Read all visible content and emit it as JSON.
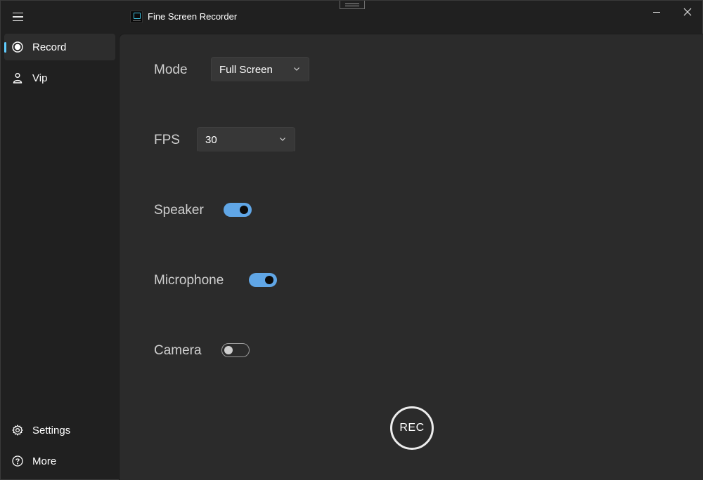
{
  "window": {
    "title": "Fine Screen Recorder"
  },
  "sidebar": {
    "top_items": [
      {
        "label": "Record",
        "icon": "record-icon",
        "selected": true
      },
      {
        "label": "Vip",
        "icon": "person-icon",
        "selected": false
      }
    ],
    "bottom_items": [
      {
        "label": "Settings",
        "icon": "gear-icon"
      },
      {
        "label": "More",
        "icon": "help-icon"
      }
    ]
  },
  "settings": {
    "mode": {
      "label": "Mode",
      "value": "Full Screen"
    },
    "fps": {
      "label": "FPS",
      "value": "30"
    },
    "speaker": {
      "label": "Speaker",
      "on": true
    },
    "microphone": {
      "label": "Microphone",
      "on": true
    },
    "camera": {
      "label": "Camera",
      "on": false
    }
  },
  "rec_button": {
    "label": "REC"
  },
  "colors": {
    "accent": "#60cdff",
    "toggle_on": "#60a6e6",
    "content_bg": "#2b2b2b",
    "sidebar_bg": "#202020"
  }
}
